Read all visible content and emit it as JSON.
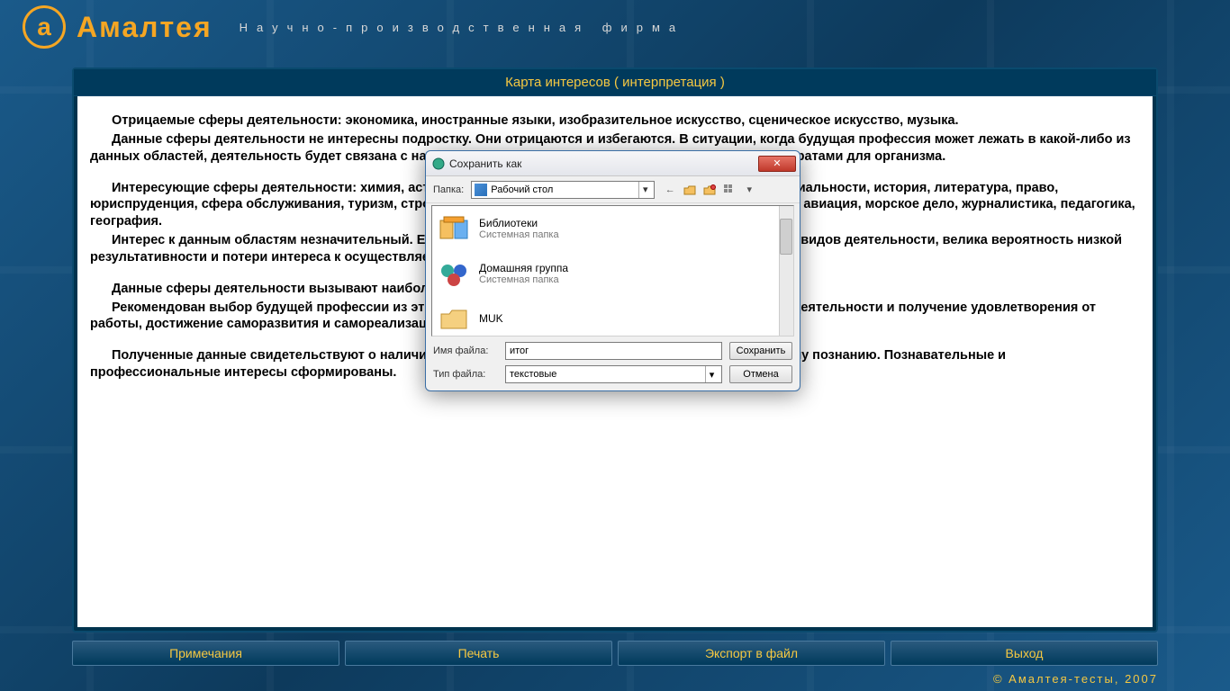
{
  "header": {
    "logo_letter": "а",
    "logo_text": "Амалтея",
    "tagline": "Научно-производственная фирма"
  },
  "title_bar": "Карта интересов    ( интерпретация )",
  "content": {
    "p1": "Отрицаемые сферы деятельности:   экономика, иностранные языки, изобразительное искусство, сценическое искусство, музыка.",
    "p2": "Данные сферы деятельности не интересны подростку. Они отрицаются и избегаются. В ситуации, когда будущая профессия может лежать в какой-либо из данных областей, деятельность будет связана с напряжением и существенными психоэнергетическими затратами для организма.",
    "p3": "Интересующие сферы деятельности:   химия, астрономия, биология, медицина, транспорт, военные специальности, история, литература, право, юриспруденция, сфера обслуживания, туризм, строительство, легкая промышленность, металлообработка, авиация, морское дело, журналистика, педагогика, география.",
    "p4": "Интерес к данным областям незначительный. Если будущая профессия связана с осуществлением этих видов деятельности, велика вероятность низкой результативности и потери интереса к осуществляемому труду.",
    "p5": "Данные сферы деятельности вызывают наибольший интерес: физика, электроника, радиотехника.",
    "p6": "Рекомендован выбор будущей профессии из этих областей. Это обеспечит высокую результативность деятельности и получение удовлетворения от работы, достижение саморазвития и самореализации.",
    "p7": "Полученные данные свидетельствуют о наличии познавательных интересов, стремлении к углубленному познанию. Познавательные и профессиональные интересы сформированы."
  },
  "buttons": {
    "notes": "Примечания",
    "print": "Печать",
    "export": "Экспорт  в  файл",
    "exit": "Выход"
  },
  "copyright": "©  Амалтея-тесты,  2007",
  "dialog": {
    "title": "Сохранить как",
    "folder_label": "Папка:",
    "folder_value": "Рабочий стол",
    "items": [
      {
        "name": "Библиотеки",
        "sub": "Системная папка"
      },
      {
        "name": "Домашняя группа",
        "sub": "Системная папка"
      },
      {
        "name": "MUK",
        "sub": ""
      }
    ],
    "filename_label": "Имя файла:",
    "filename_value": "итог",
    "filetype_label": "Тип файла:",
    "filetype_value": "текстовые",
    "save": "Сохранить",
    "cancel": "Отмена"
  }
}
